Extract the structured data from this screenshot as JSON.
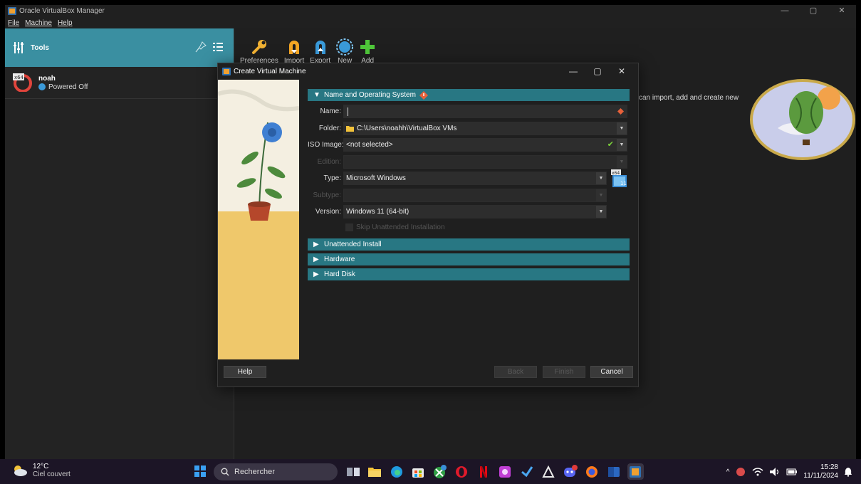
{
  "window": {
    "title": "Oracle VirtualBox Manager",
    "controls": [
      "—",
      "▢",
      "✕"
    ]
  },
  "menu": [
    "File",
    "Machine",
    "Help"
  ],
  "tools": {
    "label": "Tools"
  },
  "vm": {
    "name": "noah",
    "state": "Powered Off",
    "badge": "x64"
  },
  "toolbar": [
    {
      "label": "Preferences",
      "icon": "wrench-icon"
    },
    {
      "label": "Import",
      "icon": "import-icon"
    },
    {
      "label": "Export",
      "icon": "export-icon"
    },
    {
      "label": "New",
      "icon": "new-icon"
    },
    {
      "label": "Add",
      "icon": "add-icon"
    }
  ],
  "welcome_text": "can import, add and create new",
  "dialog": {
    "title": "Create Virtual Machine",
    "sections": {
      "name_os": "Name and Operating System",
      "unattended": "Unattended Install",
      "hardware": "Hardware",
      "hard_disk": "Hard Disk"
    },
    "labels": {
      "name": "Name:",
      "folder": "Folder:",
      "iso": "ISO Image:",
      "edition": "Edition:",
      "type": "Type:",
      "subtype": "Subtype:",
      "version": "Version:"
    },
    "values": {
      "name": "",
      "folder": "C:\\Users\\noahh\\VirtualBox VMs",
      "iso": "<not selected>",
      "edition": "",
      "type": "Microsoft Windows",
      "subtype": "",
      "version": "Windows 11 (64-bit)"
    },
    "os_badge": "x64",
    "os_badge_version": "11",
    "skip_unattended": "Skip Unattended Installation",
    "buttons": {
      "help": "Help",
      "back": "Back",
      "finish": "Finish",
      "cancel": "Cancel"
    }
  },
  "taskbar": {
    "weather": {
      "temp": "12°C",
      "condition": "Ciel couvert"
    },
    "search_placeholder": "Rechercher",
    "time": "15:28",
    "date": "11/11/2024"
  },
  "colors": {
    "accent": "#3a8fa1",
    "section": "#287783",
    "taskbar": "#1c1526"
  }
}
